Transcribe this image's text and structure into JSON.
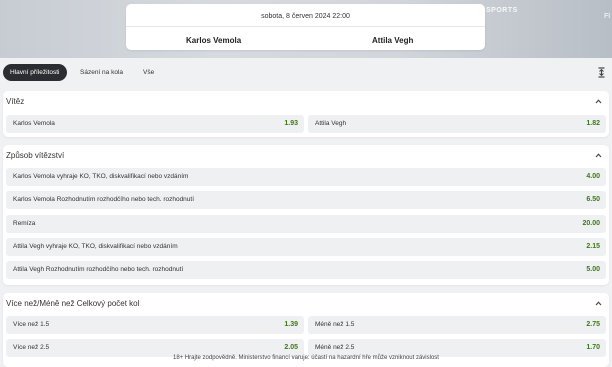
{
  "hero": {
    "watermark": "SPORTS",
    "watermark_left": "FI"
  },
  "match": {
    "date": "sobota, 8 červen 2024 22:00",
    "home": "Karlos Vemola",
    "away": "Attila Vegh"
  },
  "tabs": [
    {
      "label": "Hlavní příležitosti",
      "active": true
    },
    {
      "label": "Sázení na kola",
      "active": false
    },
    {
      "label": "Vše",
      "active": false
    }
  ],
  "markets": {
    "winner": {
      "title": "Vítěz",
      "outcomes": [
        {
          "label": "Karlos Vemola",
          "price": "1.93"
        },
        {
          "label": "Attila Vegh",
          "price": "1.82"
        }
      ]
    },
    "method": {
      "title": "Způsob vítězství",
      "outcomes": [
        {
          "label": "Karlos Vemola vyhraje KO, TKO, diskvalifikací nebo vzdáním",
          "price": "4.00"
        },
        {
          "label": "Karlos Vemola Rozhodnutím rozhodčího nebo tech. rozhodnutí",
          "price": "6.50"
        },
        {
          "label": "Remíza",
          "price": "20.00"
        },
        {
          "label": "Attila Vegh vyhraje KO, TKO, diskvalifikací nebo vzdáním",
          "price": "2.15"
        },
        {
          "label": "Attila Vegh Rozhodnutím rozhodčího nebo tech. rozhodnutí",
          "price": "5.00"
        }
      ]
    },
    "rounds": {
      "title": "Více než/Méně než Celkový počet kol",
      "outcomes": [
        {
          "label": "Více než 1.5",
          "price": "1.39"
        },
        {
          "label": "Méně než 1.5",
          "price": "2.75"
        },
        {
          "label": "Více než 2.5",
          "price": "2.05"
        },
        {
          "label": "Méně než 2.5",
          "price": "1.70"
        }
      ]
    }
  },
  "footer": "18+ Hrajte zodpovědně. Ministerstvo financí varuje: účastí na hazardní hře může vzniknout závislost",
  "colors": {
    "price": "#3d7a0f",
    "active_tab": "#2b2d33",
    "odd_bg": "#eef0f2"
  }
}
